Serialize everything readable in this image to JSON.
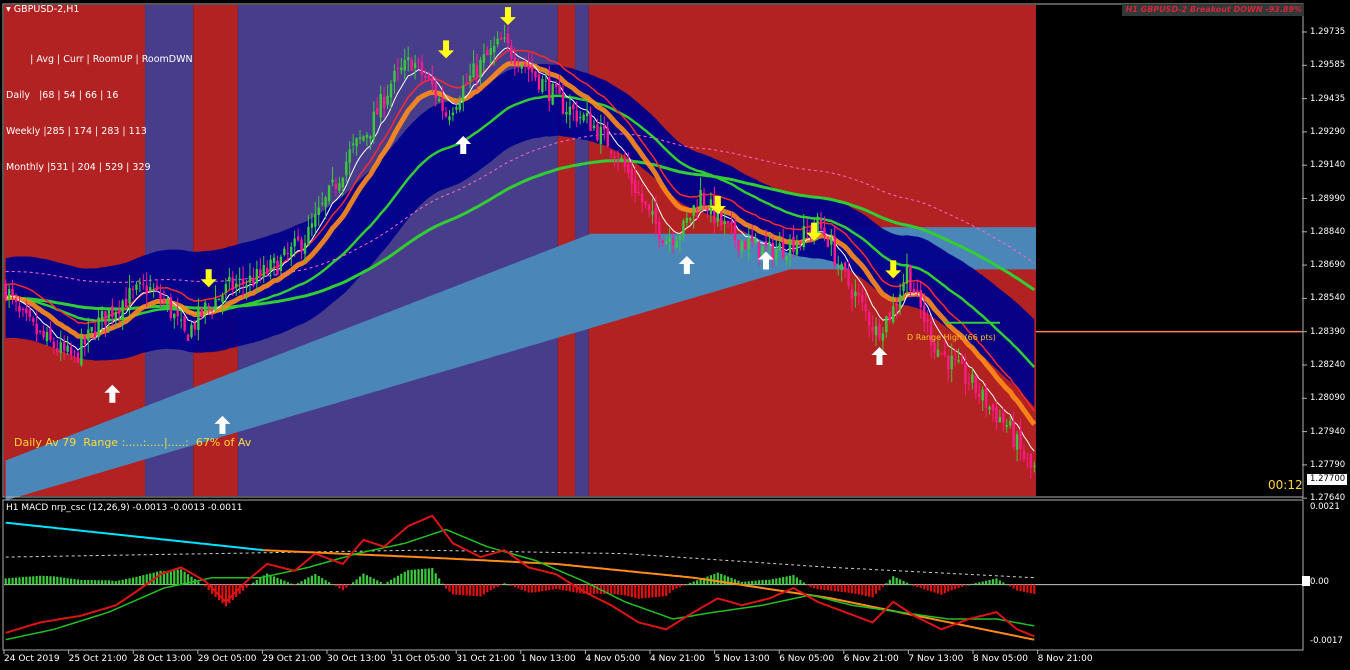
{
  "window": {
    "symbol_title": "GBPUSD-2,H1",
    "breakout_label": "H1 GBPUSD-2 Breakout DOWN -93.89%",
    "timer": "00:12",
    "range_label": "D Range High (66 pts)",
    "daily_range_text": "Daily Av 79  Range :.....:.....|.....:  67% of Av"
  },
  "stats_table": {
    "header": "        | Avg | Curr | RoomUP | RoomDWN",
    "rows": [
      {
        "label": "Daily",
        "values": "|68 | 54 | 66 | 16"
      },
      {
        "label": "Weekly",
        "values": "|285 | 174 | 283 | 113"
      },
      {
        "label": "Monthly",
        "values": "|531 | 204 | 529 | 329"
      }
    ]
  },
  "colors": {
    "bull_candle": "#3cc83c",
    "bear_candle": "#ff1a8c",
    "background_red": "#b22222",
    "background_blue": "#483d8b",
    "channel_blue": "#00008b",
    "range_lightblue": "#4a86b8",
    "ma_green": "#32cd32",
    "ma_orange": "#ff8c1a",
    "arrow_up": "#ffffff",
    "arrow_down": "#ffff1a",
    "macd_line": "#dc1414",
    "signal_line": "#22c022",
    "slow_line": "#ff8c1a",
    "cyan_line": "#00e5ff"
  },
  "chart_data": [
    {
      "type": "candlestick",
      "title": "GBPUSD-2,H1",
      "ylim": [
        1.2764,
        1.2985
      ],
      "y_ticks": [
        "1.29735",
        "1.29585",
        "1.29435",
        "1.29290",
        "1.29140",
        "1.28990",
        "1.28840",
        "1.28690",
        "1.28540",
        "1.28390",
        "1.28240",
        "1.28090",
        "1.27940",
        "1.27790",
        "1.27640"
      ],
      "current_price": "1.27700",
      "range_high_level": 1.2838,
      "x_ticks": [
        "24 Oct 2019",
        "25 Oct 21:00",
        "28 Oct 13:00",
        "29 Oct 05:00",
        "29 Oct 21:00",
        "30 Oct 13:00",
        "31 Oct 05:00",
        "31 Oct 21:00",
        "1 Nov 13:00",
        "4 Nov 05:00",
        "4 Nov 21:00",
        "5 Nov 13:00",
        "6 Nov 05:00",
        "6 Nov 21:00",
        "7 Nov 13:00",
        "8 Nov 05:00",
        "8 Nov 21:00"
      ],
      "price_path": [
        [
          0,
          1.2858
        ],
        [
          4,
          1.2845
        ],
        [
          10,
          1.2836
        ],
        [
          17,
          1.2828
        ],
        [
          20,
          1.2826
        ],
        [
          27,
          1.2842
        ],
        [
          34,
          1.2852
        ],
        [
          41,
          1.2858
        ],
        [
          47,
          1.285
        ],
        [
          52,
          1.2836
        ],
        [
          58,
          1.2848
        ],
        [
          65,
          1.2858
        ],
        [
          73,
          1.2862
        ],
        [
          82,
          1.2872
        ],
        [
          88,
          1.2882
        ],
        [
          95,
          1.2902
        ],
        [
          100,
          1.2918
        ],
        [
          106,
          1.293
        ],
        [
          112,
          1.295
        ],
        [
          118,
          1.296
        ],
        [
          124,
          1.2948
        ],
        [
          128,
          1.2936
        ],
        [
          134,
          1.295
        ],
        [
          139,
          1.296
        ],
        [
          144,
          1.2968
        ],
        [
          150,
          1.296
        ],
        [
          156,
          1.295
        ],
        [
          162,
          1.294
        ],
        [
          170,
          1.2932
        ],
        [
          177,
          1.292
        ],
        [
          182,
          1.2906
        ],
        [
          187,
          1.289
        ],
        [
          192,
          1.288
        ],
        [
          197,
          1.2884
        ],
        [
          202,
          1.29
        ],
        [
          207,
          1.2888
        ],
        [
          212,
          1.288
        ],
        [
          218,
          1.2876
        ],
        [
          222,
          1.2874
        ],
        [
          226,
          1.2876
        ],
        [
          231,
          1.288
        ],
        [
          236,
          1.2886
        ],
        [
          239,
          1.288
        ],
        [
          243,
          1.2864
        ],
        [
          248,
          1.2852
        ],
        [
          253,
          1.2838
        ],
        [
          258,
          1.2848
        ],
        [
          262,
          1.2866
        ],
        [
          265,
          1.2852
        ],
        [
          270,
          1.2832
        ],
        [
          276,
          1.2822
        ],
        [
          281,
          1.2814
        ],
        [
          286,
          1.2804
        ],
        [
          291,
          1.2796
        ],
        [
          295,
          1.2784
        ],
        [
          298,
          1.2776
        ]
      ],
      "n_bars": 300,
      "arrows_up": [
        {
          "bar": 31,
          "price": 1.281
        },
        {
          "bar": 63,
          "price": 1.2796
        },
        {
          "bar": 133,
          "price": 1.2922
        },
        {
          "bar": 198,
          "price": 1.2868
        },
        {
          "bar": 221,
          "price": 1.287
        },
        {
          "bar": 254,
          "price": 1.2827
        }
      ],
      "arrows_down": [
        {
          "bar": 59,
          "price": 1.2862
        },
        {
          "bar": 128,
          "price": 1.2965
        },
        {
          "bar": 146,
          "price": 1.298
        },
        {
          "bar": 207,
          "price": 1.2895
        },
        {
          "bar": 235,
          "price": 1.2883
        },
        {
          "bar": 258,
          "price": 1.2866
        }
      ],
      "background_zones": [
        {
          "start": 0,
          "end": 41,
          "color": "red"
        },
        {
          "start": 41,
          "end": 55,
          "color": "blue"
        },
        {
          "start": 55,
          "end": 68,
          "color": "red"
        },
        {
          "start": 68,
          "end": 161,
          "color": "blue"
        },
        {
          "start": 161,
          "end": 166,
          "color": "red"
        },
        {
          "start": 166,
          "end": 170,
          "color": "blue"
        },
        {
          "start": 170,
          "end": 300,
          "color": "red"
        }
      ]
    },
    {
      "type": "macd",
      "title": "H1 MACD nrp_csc (12,26,9) -0.0013 -0.0013 -0.0011",
      "ylim": [
        -0.0019,
        0.0024
      ],
      "y_ticks": [
        "0.0021",
        "0.00",
        "-0.0017"
      ],
      "macd_path": [
        [
          0,
          -0.0014
        ],
        [
          10,
          -0.0011
        ],
        [
          22,
          -0.0009
        ],
        [
          32,
          -0.0006
        ],
        [
          38,
          -0.0002
        ],
        [
          45,
          0.0003
        ],
        [
          51,
          0.0005
        ],
        [
          58,
          0.0001
        ],
        [
          64,
          -0.0005
        ],
        [
          70,
          0.0001
        ],
        [
          76,
          0.0006
        ],
        [
          84,
          0.0004
        ],
        [
          90,
          0.0009
        ],
        [
          98,
          0.0006
        ],
        [
          104,
          0.0013
        ],
        [
          110,
          0.0011
        ],
        [
          117,
          0.0017
        ],
        [
          124,
          0.002
        ],
        [
          130,
          0.0012
        ],
        [
          138,
          0.0008
        ],
        [
          145,
          0.001
        ],
        [
          152,
          0.0005
        ],
        [
          160,
          0.0003
        ],
        [
          168,
          -0.0002
        ],
        [
          176,
          -0.0006
        ],
        [
          184,
          -0.0011
        ],
        [
          192,
          -0.0013
        ],
        [
          200,
          -0.0008
        ],
        [
          207,
          -0.0004
        ],
        [
          214,
          -0.0006
        ],
        [
          222,
          -0.0004
        ],
        [
          229,
          -0.0001
        ],
        [
          236,
          -0.0005
        ],
        [
          244,
          -0.0008
        ],
        [
          252,
          -0.0011
        ],
        [
          258,
          -0.0005
        ],
        [
          264,
          -0.0009
        ],
        [
          272,
          -0.0013
        ],
        [
          280,
          -0.001
        ],
        [
          288,
          -0.0008
        ],
        [
          294,
          -0.0013
        ],
        [
          299,
          -0.0015
        ]
      ],
      "signal_path": [
        [
          0,
          -0.0016
        ],
        [
          14,
          -0.0013
        ],
        [
          30,
          -0.0008
        ],
        [
          46,
          -0.0001
        ],
        [
          60,
          0.0002
        ],
        [
          74,
          0.0002
        ],
        [
          88,
          0.0005
        ],
        [
          102,
          0.0009
        ],
        [
          116,
          0.0012
        ],
        [
          128,
          0.0016
        ],
        [
          140,
          0.0011
        ],
        [
          154,
          0.0007
        ],
        [
          168,
          0.0001
        ],
        [
          180,
          -0.0005
        ],
        [
          194,
          -0.001
        ],
        [
          206,
          -0.0008
        ],
        [
          220,
          -0.0006
        ],
        [
          234,
          -0.0003
        ],
        [
          246,
          -0.0006
        ],
        [
          260,
          -0.0008
        ],
        [
          274,
          -0.001
        ],
        [
          288,
          -0.001
        ],
        [
          299,
          -0.0012
        ]
      ],
      "slow_path": [
        [
          75,
          0.001
        ],
        [
          120,
          0.0008
        ],
        [
          160,
          0.0006
        ],
        [
          200,
          0.0002
        ],
        [
          240,
          -0.0004
        ],
        [
          299,
          -0.0016
        ]
      ],
      "cyan_path": [
        [
          0,
          0.0018
        ],
        [
          75,
          0.001
        ]
      ],
      "dashed_path": [
        [
          0,
          0.0008
        ],
        [
          60,
          0.0009
        ],
        [
          120,
          0.001
        ],
        [
          180,
          0.0009
        ],
        [
          240,
          0.0005
        ],
        [
          299,
          0.0002
        ]
      ]
    }
  ]
}
